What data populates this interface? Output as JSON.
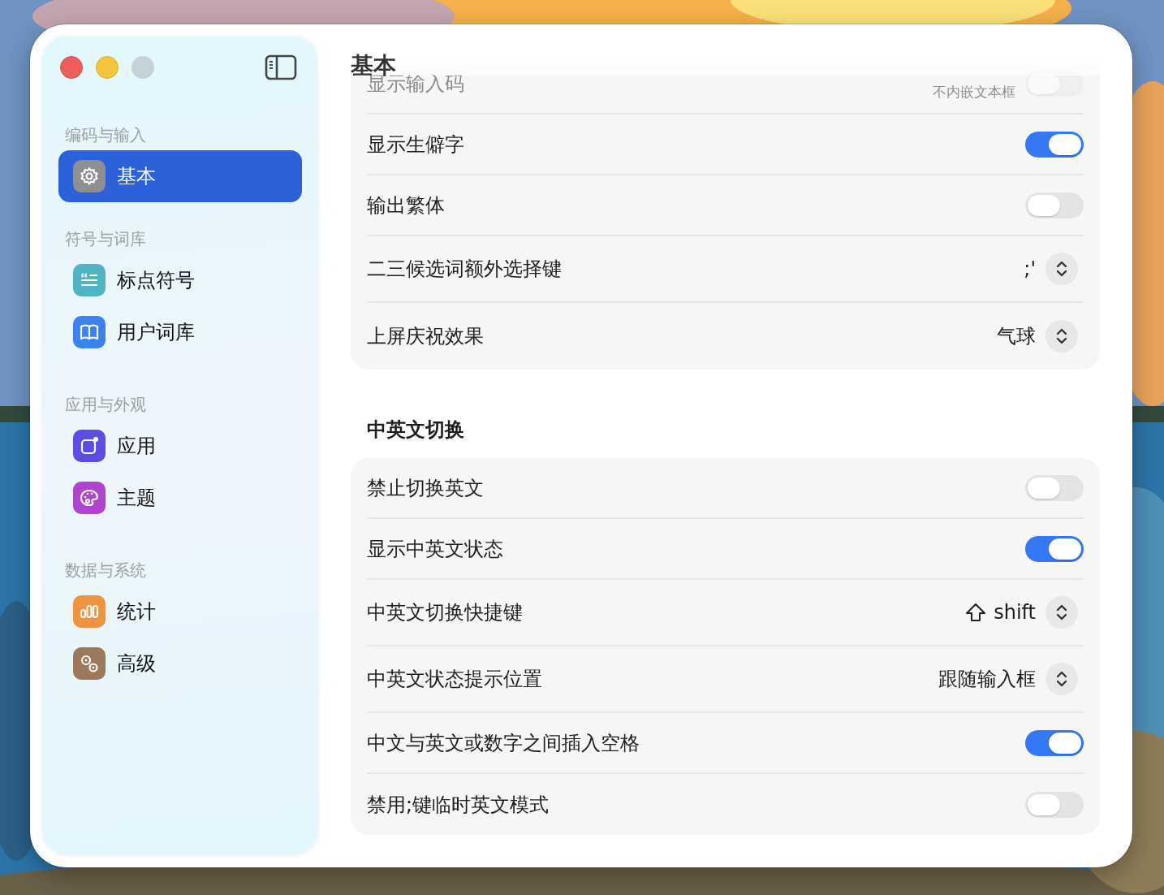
{
  "sidebar": {
    "sections": [
      {
        "title": "编码与输入",
        "items": [
          {
            "label": "基本",
            "color": "#8e8e93",
            "selected": true
          }
        ]
      },
      {
        "title": "符号与词库",
        "items": [
          {
            "label": "标点符号",
            "color": "#4fb5c2",
            "selected": false
          },
          {
            "label": "用户词库",
            "color": "#3a82ef",
            "selected": false
          }
        ]
      },
      {
        "title": "应用与外观",
        "items": [
          {
            "label": "应用",
            "color": "#5a4fe0",
            "selected": false
          },
          {
            "label": "主题",
            "color": "#b044cf",
            "selected": false
          }
        ]
      },
      {
        "title": "数据与系统",
        "items": [
          {
            "label": "统计",
            "color": "#ee9340",
            "selected": false
          },
          {
            "label": "高级",
            "color": "#9c785c",
            "selected": false
          }
        ]
      }
    ]
  },
  "page": {
    "title": "基本",
    "groups": [
      {
        "rows": [
          {
            "kind": "toggle",
            "label": "显示输入码",
            "note": "不内嵌文本框",
            "on": false,
            "obscured": true
          },
          {
            "kind": "toggle",
            "label": "显示生僻字",
            "on": true
          },
          {
            "kind": "toggle",
            "label": "输出繁体",
            "on": false
          },
          {
            "kind": "select",
            "label": "二三候选词额外选择键",
            "value": ";'"
          },
          {
            "kind": "select",
            "label": "上屏庆祝效果",
            "value": "气球"
          }
        ]
      },
      {
        "title": "中英文切换",
        "rows": [
          {
            "kind": "toggle",
            "label": "禁止切换英文",
            "on": false
          },
          {
            "kind": "toggle",
            "label": "显示中英文状态",
            "on": true
          },
          {
            "kind": "select",
            "label": "中英文切换快捷键",
            "value": "shift",
            "shift_icon": true
          },
          {
            "kind": "select",
            "label": "中英文状态提示位置",
            "value": "跟随输入框"
          },
          {
            "kind": "toggle",
            "label": "中文与英文或数字之间插入空格",
            "on": true
          },
          {
            "kind": "toggle",
            "label": "禁用;键临时英文模式",
            "on": false
          }
        ]
      }
    ]
  }
}
